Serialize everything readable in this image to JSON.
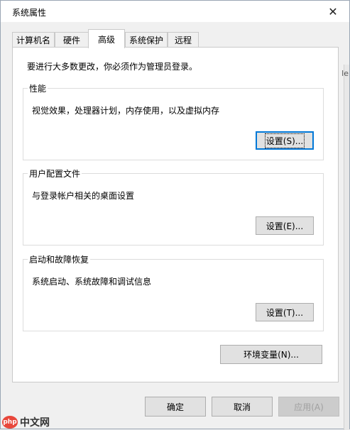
{
  "window": {
    "title": "系统属性",
    "close_symbol": "✕"
  },
  "tabs": [
    {
      "label": "计算机名"
    },
    {
      "label": "硬件"
    },
    {
      "label": "高级"
    },
    {
      "label": "系统保护"
    },
    {
      "label": "远程"
    }
  ],
  "active_tab": "高级",
  "notice": "要进行大多数更改，你必须作为管理员登录。",
  "groups": {
    "performance": {
      "title": "性能",
      "description": "视觉效果，处理器计划，内存使用，以及虚拟内存",
      "button": "设置(S)..."
    },
    "user_profiles": {
      "title": "用户配置文件",
      "description": "与登录帐户相关的桌面设置",
      "button": "设置(E)..."
    },
    "startup_recovery": {
      "title": "启动和故障恢复",
      "description": "系统启动、系统故障和调试信息",
      "button": "设置(T)..."
    }
  },
  "env_button": "环境变量(N)...",
  "footer": {
    "ok": "确定",
    "cancel": "取消",
    "apply": "应用(A)"
  },
  "watermark": {
    "icon_text": "php",
    "text": "中文网"
  },
  "background_fragment": "le",
  "colors": {
    "focus_blue": "#0078d7",
    "button_bg": "#e1e1e1",
    "panel_bg": "#ffffff",
    "window_bg": "#f0f0f0"
  }
}
